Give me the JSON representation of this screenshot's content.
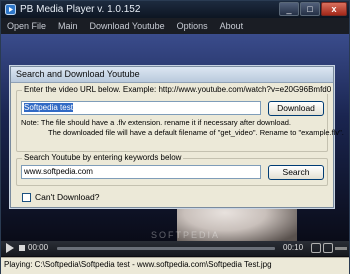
{
  "window": {
    "title": "PB Media Player v. 1.0.152",
    "controls": {
      "minimize": "_",
      "maximize": "□",
      "close": "x"
    }
  },
  "menu": [
    "Open File",
    "Main",
    "Download Youtube",
    "Options",
    "About"
  ],
  "player": {
    "time_elapsed": "00:00",
    "time_total": "00:10",
    "progress": 0,
    "watermark": "SOFTPEDIA"
  },
  "status": "Playing: C:\\Softpedia\\Softpedia test - www.softpedia.com\\Softpedia Test.jpg",
  "dialog": {
    "title": "Search and Download Youtube",
    "url_group_caption": "Enter the video URL below. Example: http://www.youtube.com/watch?v=e20G96Bmfd0",
    "url_value": "Softpedia test",
    "download_label": "Download",
    "note_line1": "Note: The file should have a .flv extension. rename it if necessary after download.",
    "note_line2": "The downloaded file will have a default filename of \"get_video\". Rename to \"example.flv\".",
    "search_group_caption": "Search Youtube by entering keywords below",
    "search_value": "www.softpedia.com",
    "search_label": "Search",
    "cant_download_label": "Can't Download?",
    "cant_download_checked": false
  }
}
